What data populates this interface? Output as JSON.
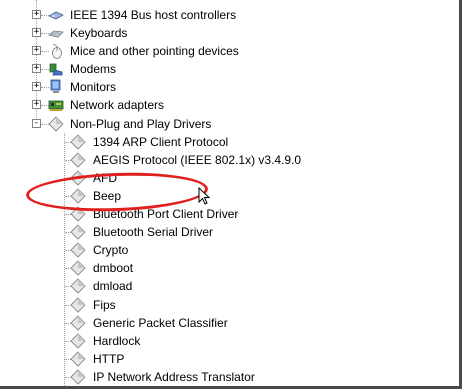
{
  "tree": {
    "categories": [
      {
        "label": "IEEE 1394 Bus host controllers",
        "icon": "ieee1394-icon",
        "expander": "+"
      },
      {
        "label": "Keyboards",
        "icon": "keyboard-icon",
        "expander": "+"
      },
      {
        "label": "Mice and other pointing devices",
        "icon": "mouse-icon",
        "expander": "+"
      },
      {
        "label": "Modems",
        "icon": "modem-icon",
        "expander": "+"
      },
      {
        "label": "Monitors",
        "icon": "monitor-icon",
        "expander": "+"
      },
      {
        "label": "Network adapters",
        "icon": "network-adapter-icon",
        "expander": "+"
      },
      {
        "label": "Non-Plug and Play Drivers",
        "icon": "driver-icon",
        "expander": "-"
      }
    ],
    "drivers": [
      "1394 ARP Client Protocol",
      "AEGIS Protocol (IEEE 802.1x) v3.4.9.0",
      "AFD",
      "Beep",
      "Bluetooth Port Client Driver",
      "Bluetooth Serial Driver",
      "Crypto",
      "dmboot",
      "dmload",
      "Fips",
      "Generic Packet Classifier",
      "Hardlock",
      "HTTP",
      "IP Network Address Translator"
    ],
    "highlighted_item": "Beep"
  },
  "colors": {
    "annotation": "#e0201e",
    "frame_border": "#4a4a4a",
    "tree_lines": "#a0a0a0"
  }
}
